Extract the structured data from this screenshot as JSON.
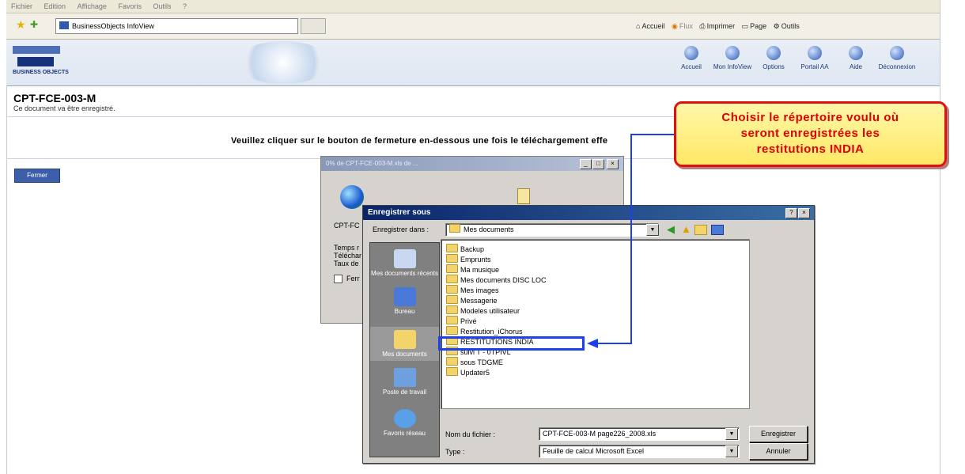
{
  "ie": {
    "menu": [
      "Fichier",
      "Edition",
      "Affichage",
      "Favoris",
      "Outils",
      "?"
    ],
    "tab_title": "BusinessObjects InfoView",
    "toolbar": {
      "home": "Accueil",
      "feeds": "Flux",
      "print": "Imprimer",
      "page": "Page",
      "tools": "Outils"
    }
  },
  "bo": {
    "logo_text": "BUSINESS OBJECTS",
    "nav": [
      "Accueil",
      "Mon InfoView",
      "Options",
      "Portail AA",
      "Aide",
      "Déconnexion"
    ]
  },
  "page": {
    "title": "CPT-FCE-003-M",
    "subtitle": "Ce document va être enregistré.",
    "instruction": "Veuillez cliquer sur le bouton de fermeture en-dessous une fois le téléchargement effe",
    "close_button": "Fermer"
  },
  "download_dialog": {
    "title": "0% de CPT-FCE-003-M.xls de ...",
    "lines": [
      "CPT-FC",
      "Temps r",
      "Téléchar",
      "Taux de",
      "Ferr"
    ]
  },
  "save_dialog": {
    "title": "Enregistrer sous",
    "save_in_label": "Enregistrer dans :",
    "save_in_value": "Mes documents",
    "places": [
      "Mes documents récents",
      "Bureau",
      "Mes documents",
      "Poste de travail",
      "Favoris réseau"
    ],
    "folders": [
      "Backup",
      "Emprunts",
      "Ma musique",
      "Mes documents DISC LOC",
      "Mes images",
      "Messagerie",
      "Modeles utilisateur",
      "Privé",
      "Restitution_iChorus",
      "RESTITUTIONS INDIA",
      "suivi T - 0TPIVL",
      "sous TDGME",
      "Updater5"
    ],
    "filename_label": "Nom du fichier :",
    "filename_value": "CPT-FCE-003-M page226_2008.xls",
    "type_label": "Type :",
    "type_value": "Feuille de calcul Microsoft Excel",
    "save_button": "Enregistrer",
    "cancel_button": "Annuler"
  },
  "callout": {
    "lines": [
      "Choisir le répertoire voulu où",
      "seront enregistrées les",
      "restitutions INDIA"
    ]
  },
  "colors": {
    "callout_border": "#e01010",
    "callout_fill": "#ffef80",
    "arrow": "#1e3ff0",
    "dialog_title": "#0a246a"
  }
}
